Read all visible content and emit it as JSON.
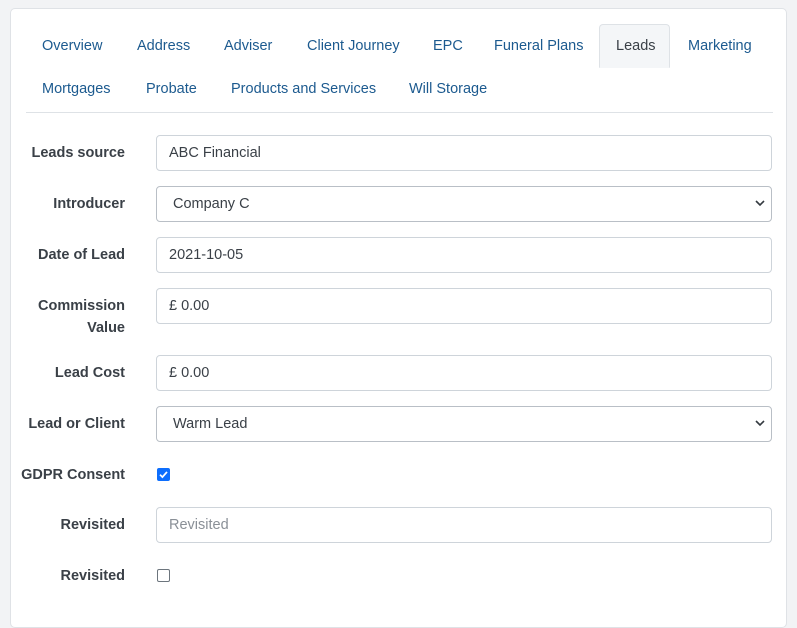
{
  "tabs": [
    {
      "label": "Overview",
      "active": false
    },
    {
      "label": "Address",
      "active": false
    },
    {
      "label": "Adviser",
      "active": false
    },
    {
      "label": "Client Journey",
      "active": false
    },
    {
      "label": "EPC",
      "active": false
    },
    {
      "label": "Funeral Plans",
      "active": false
    },
    {
      "label": "Leads",
      "active": true
    },
    {
      "label": "Marketing",
      "active": false
    },
    {
      "label": "Mortgages",
      "active": false
    },
    {
      "label": "Probate",
      "active": false
    },
    {
      "label": "Products and Services",
      "active": false
    },
    {
      "label": "Will Storage",
      "active": false
    }
  ],
  "form": {
    "leads_source": {
      "label": "Leads source",
      "value": "ABC Financial"
    },
    "introducer": {
      "label": "Introducer",
      "value": "Company C"
    },
    "date_of_lead": {
      "label": "Date of Lead",
      "value": "2021-10-05"
    },
    "commission_value": {
      "label_line1": "Commission",
      "label_line2": "Value",
      "value": "£ 0.00"
    },
    "lead_cost": {
      "label": "Lead Cost",
      "value": "£ 0.00"
    },
    "lead_or_client": {
      "label": "Lead or Client",
      "value": "Warm Lead"
    },
    "gdpr_consent": {
      "label": "GDPR Consent",
      "checked": true
    },
    "revisited_text": {
      "label": "Revisited",
      "value": "",
      "placeholder": "Revisited"
    },
    "revisited_check": {
      "label": "Revisited",
      "checked": false
    }
  },
  "colors": {
    "link": "#1c5a8f",
    "checkbox_accent": "#0d6efd"
  },
  "icons": {
    "select_arrow": "chevron-down-icon",
    "checkmark": "check-icon"
  }
}
